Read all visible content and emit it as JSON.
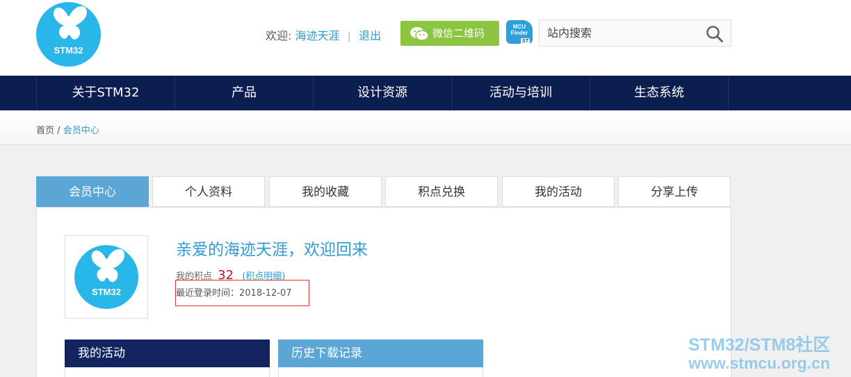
{
  "header": {
    "logo_text": "STM32",
    "welcome_label": "欢迎:",
    "username": "海迹天涯",
    "logout": "退出",
    "wechat_button": "微信二维码",
    "mcu_badge_line1": "MCU",
    "mcu_badge_line2": "Finder",
    "mcu_badge_brand": "ST",
    "search_placeholder": "站内搜索"
  },
  "nav": {
    "items": [
      {
        "label": "关于STM32"
      },
      {
        "label": "产品"
      },
      {
        "label": "设计资源"
      },
      {
        "label": "活动与培训"
      },
      {
        "label": "生态系统"
      }
    ]
  },
  "breadcrumb": {
    "home": "首页",
    "separator": "/",
    "current": "会员中心"
  },
  "tabs": [
    {
      "label": "会员中心",
      "active": true
    },
    {
      "label": "个人资料"
    },
    {
      "label": "我的收藏"
    },
    {
      "label": "积点兑换"
    },
    {
      "label": "我的活动"
    },
    {
      "label": "分享上传"
    }
  ],
  "profile": {
    "greeting": "亲爱的海迹天涯，欢迎回来",
    "points_label": "我的积点",
    "points": "32",
    "points_detail": "(积点明细)",
    "last_login": "最近登录时间：2018-12-07"
  },
  "sections": {
    "activities": "我的活动",
    "downloads": "历史下载记录"
  },
  "watermark": {
    "line1": "STM32/STM8社区",
    "line2": "www.stmcu.org.cn"
  },
  "colors": {
    "nav_bg": "#0c1d4f",
    "accent": "#2f9bd1",
    "tab_active": "#5ba6d4",
    "wechat_green": "#8cc53f",
    "logo_blue": "#29b6e8",
    "activity_head": "#142461",
    "download_head": "#5ba6d4"
  }
}
